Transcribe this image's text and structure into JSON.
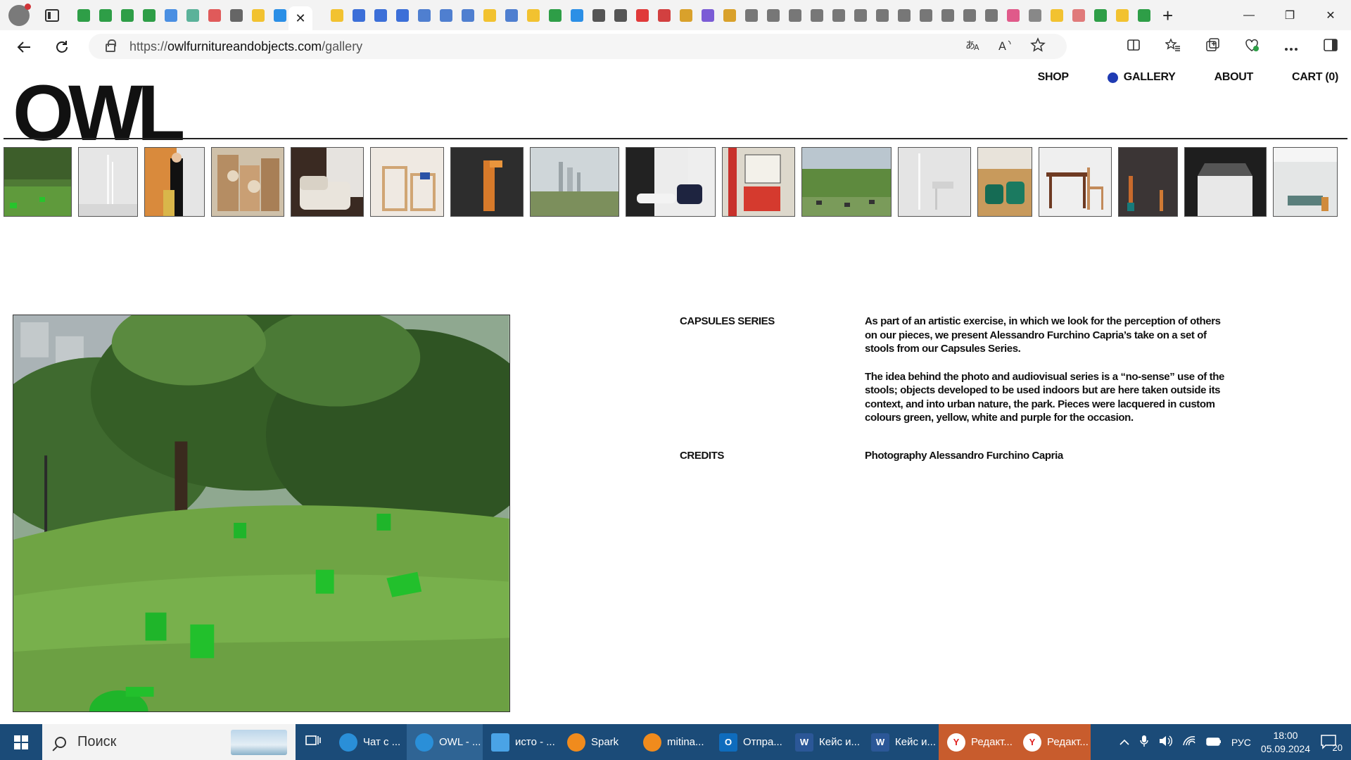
{
  "browser": {
    "url_prefix": "https://",
    "url_host": "owlfurnitureandobjects.com",
    "url_path": "/gallery",
    "tab_close_glyph": "✕",
    "new_tab_glyph": "+",
    "window_controls": {
      "minimize": "—",
      "restore": "❐",
      "close": "✕"
    }
  },
  "site": {
    "logo": "OWL",
    "nav": {
      "shop": "SHOP",
      "gallery": "GALLERY",
      "about": "ABOUT",
      "cart": "CART (0)"
    },
    "accent_color": "#1f3bb3"
  },
  "project": {
    "title_label": "CAPSULES SERIES",
    "paragraphs": [
      "As part of an artistic exercise, in which we look for the perception of others on our pieces, we present Alessandro Furchino Capria’s take on a set of stools from our Capsules Series.",
      "The idea behind the photo and audiovisual series is a “no-sense” use of the stools; objects developed to be used indoors but are here taken outside its context, and into urban nature, the park. Pieces were lacquered in custom colours green, yellow, white and purple for the occasion."
    ],
    "credits_label": "CREDITS",
    "credits_text": "Photography Alessandro Furchino Capria"
  },
  "taskbar": {
    "search_placeholder": "Поиск",
    "apps": [
      {
        "label": "Чат с ...",
        "icon": "edge-icon",
        "color": "#2a8fd8"
      },
      {
        "label": "OWL - ...",
        "icon": "edge-icon",
        "color": "#2a8fd8"
      },
      {
        "label": "исто - ...",
        "icon": "notes-icon",
        "color": "#4aa3e6"
      },
      {
        "label": "Spark",
        "icon": "spark-icon",
        "color": "#f08b1d"
      },
      {
        "label": "mitina...",
        "icon": "spark-icon",
        "color": "#f08b1d"
      },
      {
        "label": "Отпра...",
        "icon": "outlook-icon",
        "color": "#0f6cbd"
      },
      {
        "label": "Кейс и...",
        "icon": "word-icon",
        "color": "#2b5797"
      },
      {
        "label": "Кейс и...",
        "icon": "word-icon",
        "color": "#2b5797"
      },
      {
        "label": "Редакт...",
        "icon": "yandex-icon",
        "color": "#ffffff"
      },
      {
        "label": "Редакт...",
        "icon": "yandex-icon",
        "color": "#ffffff"
      }
    ],
    "language": "РУС",
    "time": "18:00",
    "date": "05.09.2024",
    "notification_count": "20"
  }
}
